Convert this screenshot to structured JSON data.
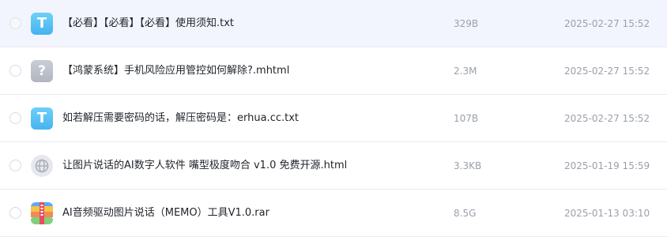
{
  "files": [
    {
      "name": "【必看】【必看】【必看】使用须知.txt",
      "size": "329B",
      "date": "2025-02-27 15:52",
      "icon": "txt-file-icon",
      "icon_glyph": "T",
      "selected": false
    },
    {
      "name": "【鸿蒙系统】手机风险应用管控如何解除?.mhtml",
      "size": "2.3M",
      "date": "2025-02-27 15:52",
      "icon": "unknown-file-icon",
      "icon_glyph": "?",
      "selected": false
    },
    {
      "name": "如若解压需要密码的话，解压密码是：erhua.cc.txt",
      "size": "107B",
      "date": "2025-02-27 15:52",
      "icon": "txt-file-icon",
      "icon_glyph": "T",
      "selected": false
    },
    {
      "name": "让图片说话的AI数字人软件 嘴型极度吻合 v1.0 免费开源.html",
      "size": "3.3KB",
      "date": "2025-01-19 15:59",
      "icon": "html-file-icon",
      "icon_glyph": "",
      "selected": false
    },
    {
      "name": "AI音频驱动图片说话（MEMO）工具V1.0.rar",
      "size": "8.5G",
      "date": "2025-01-13 03:10",
      "icon": "rar-archive-icon",
      "icon_glyph": "",
      "selected": false
    }
  ],
  "colors": {
    "highlight_row": "#f2f5fd",
    "txt_icon": "#5cc3f4",
    "unknown_icon": "#bcc1cb",
    "text_primary": "#1f2329",
    "text_secondary": "#9aa0ab",
    "divider": "#ececf0"
  }
}
